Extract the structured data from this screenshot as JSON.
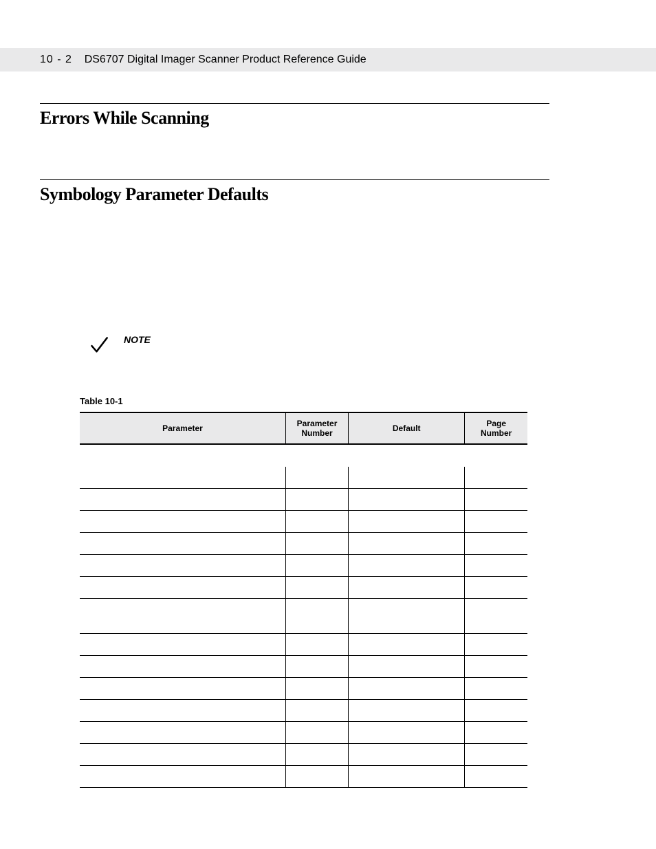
{
  "header": {
    "page_number": "10 - 2",
    "title": "DS6707 Digital Imager Scanner Product Reference Guide"
  },
  "sections": {
    "errors": "Errors While Scanning",
    "defaults": "Symbology Parameter Defaults"
  },
  "note": {
    "label": "NOTE"
  },
  "table": {
    "label": "Table 10-1",
    "headers": {
      "parameter": "Parameter",
      "parameter_number": "Parameter\nNumber",
      "default": "Default",
      "page_number": "Page\nNumber"
    },
    "rows": [
      {
        "parameter": "",
        "parameter_number": "",
        "default": "",
        "page_number": "",
        "section": true
      },
      {
        "parameter": "",
        "parameter_number": "",
        "default": "",
        "page_number": ""
      },
      {
        "parameter": "",
        "parameter_number": "",
        "default": "",
        "page_number": ""
      },
      {
        "parameter": "",
        "parameter_number": "",
        "default": "",
        "page_number": ""
      },
      {
        "parameter": "",
        "parameter_number": "",
        "default": "",
        "page_number": ""
      },
      {
        "parameter": "",
        "parameter_number": "",
        "default": "",
        "page_number": ""
      },
      {
        "parameter": "",
        "parameter_number": "",
        "default": "",
        "page_number": ""
      },
      {
        "parameter": "",
        "parameter_number": "",
        "default": "",
        "page_number": "",
        "tall": true
      },
      {
        "parameter": "",
        "parameter_number": "",
        "default": "",
        "page_number": ""
      },
      {
        "parameter": "",
        "parameter_number": "",
        "default": "",
        "page_number": ""
      },
      {
        "parameter": "",
        "parameter_number": "",
        "default": "",
        "page_number": ""
      },
      {
        "parameter": "",
        "parameter_number": "",
        "default": "",
        "page_number": ""
      },
      {
        "parameter": "",
        "parameter_number": "",
        "default": "",
        "page_number": ""
      },
      {
        "parameter": "",
        "parameter_number": "",
        "default": "",
        "page_number": ""
      },
      {
        "parameter": "",
        "parameter_number": "",
        "default": "",
        "page_number": ""
      }
    ]
  }
}
